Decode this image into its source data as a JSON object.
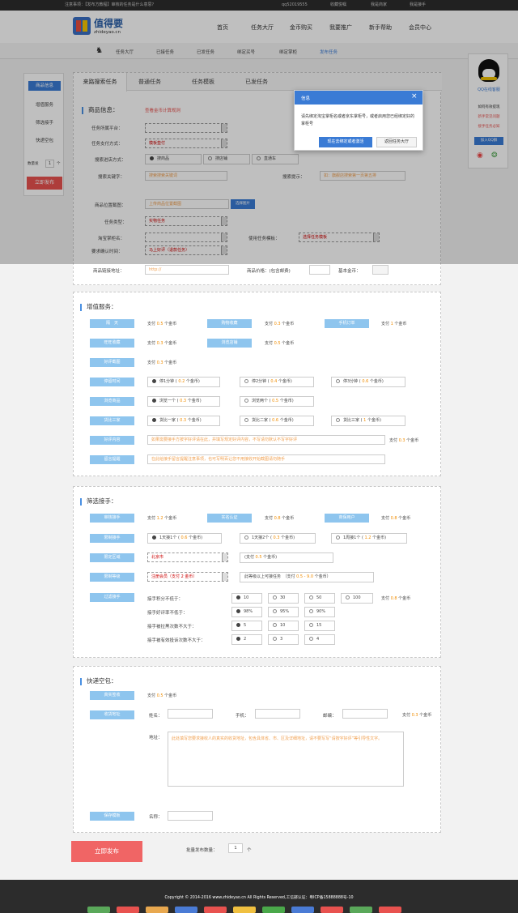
{
  "topbar": {
    "notice": "注意事项：【发布方教程】审核的任务是什么意思？",
    "qq": "qq52019555",
    "fav": "收藏悦嘱",
    "merchant": "我是商家",
    "worker": "我是接手"
  },
  "header": {
    "logo_main": "值得要",
    "logo_sub": "zhideyao.cn",
    "nav": [
      "首页",
      "任务大厅",
      "金币购买",
      "我要推广",
      "新手帮助",
      "会员中心"
    ]
  },
  "subnav": [
    "任务大厅",
    "已接任务",
    "已发任务",
    "绑定买号",
    "绑定掌柜",
    "发布任务"
  ],
  "left_sidebar": {
    "items": [
      "商品信息",
      "增值服务",
      "筛选接手",
      "快递空包"
    ],
    "qty_label": "数量发",
    "qty_value": "1",
    "qty_unit": "个",
    "publish": "立即发布"
  },
  "right_sidebar": {
    "qq_label": "QQ在线客服",
    "links": [
      "如何有效提现",
      "新手常见问题",
      "接手任务必知"
    ],
    "join": "加入QQ群"
  },
  "tabs": [
    "来路搜索任务",
    "普通任务",
    "任务模板",
    "已发任务"
  ],
  "product": {
    "title": "商品信息：",
    "calc_link": "查看金币计算规则",
    "platform_label": "任务所属平台：",
    "pay_label": "任务支付方式：",
    "pay_value": "模板垫付",
    "shop_label": "搜索进店方式：",
    "shop_opts": [
      "搜商品",
      "搜店铺",
      "直通车"
    ],
    "kw_label": "搜索关键字：",
    "kw_ph": "搜索搜索关键词",
    "tip_label": "搜索提示：",
    "tip_ph": "如：旗舰店搜索第一页第五排",
    "pos_label": "商品位置截图：",
    "pos_ph": "上传商品位置截图",
    "pos_btn": "选择图片",
    "type_label": "任务类型：",
    "type_value": "实物任务",
    "shop_name_label": "淘宝掌柜名：",
    "tpl_label": "使用任务模板：",
    "tpl_value": "选择任务模板",
    "confirm_label": "要求确认时间：",
    "confirm_value": "马上好评（退款任务）",
    "link_label": "商品链接地址：",
    "link_ph": "http://",
    "price_label": "商品价格：(包含邮费)",
    "base_label": "基本金币："
  },
  "dialog": {
    "title": "信息",
    "close": "×",
    "text": "请先绑定淘宝掌柜名或者京东掌柜号，或者启用您已经绑定好的掌柜号",
    "btn_bind": "现在去绑定或者激活",
    "btn_back": "返回任务大厅"
  },
  "value_added": {
    "title": "增值服务：",
    "r1": [
      {
        "btn": "隔　天",
        "pay": "支付",
        "val": "0.5",
        "unit": "个金币"
      },
      {
        "btn": "购物收藏",
        "pay": "支付",
        "val": "0.3",
        "unit": "个金币"
      },
      {
        "btn": "手机订单",
        "pay": "支付",
        "val": "1",
        "unit": "个金币"
      }
    ],
    "r2": [
      {
        "btn": "旺旺收藏",
        "pay": "支付",
        "val": "0.3",
        "unit": "个金币"
      },
      {
        "btn": "浏览店铺",
        "pay": "支付",
        "val": "0.5",
        "unit": "个金币"
      }
    ],
    "r3": {
      "btn": "好评截图",
      "pay": "支付",
      "val": "0.3",
      "unit": "个金币"
    },
    "stay": {
      "btn": "停留时间",
      "opts": [
        [
          "停1分钟",
          "0.2"
        ],
        [
          "停2分钟",
          "0.4"
        ],
        [
          "停3分钟",
          "0.6"
        ]
      ]
    },
    "browse": {
      "btn": "浏览商品",
      "opts": [
        [
          "浏览一个",
          "0.3"
        ],
        [
          "浏览两个",
          "0.5"
        ]
      ]
    },
    "compare": {
      "btn": "货比三家",
      "opts": [
        [
          "货比一家",
          "0.3"
        ],
        [
          "货比二家",
          "0.6"
        ],
        [
          "货比三家",
          "1"
        ]
      ]
    },
    "coin_unit": "个金币",
    "review": {
      "btn": "好评内容",
      "ph": "如果需要接手方按字好评请在此，并填写规定好评内容，不写请勿默认不写字好评",
      "pay": "支付",
      "val": "0.3",
      "unit": "个金币"
    },
    "msg": {
      "btn": "留言提醒",
      "ph": "在此给接手留言提醒注意事项，也可写明百让您不用接收开始截图请勿随手"
    }
  },
  "filter": {
    "title": "筛选接手：",
    "r1": [
      {
        "btn": "审核接手",
        "pay": "支付",
        "val": "1.2",
        "unit": "个金币"
      },
      {
        "btn": "实名认证",
        "pay": "支付",
        "val": "0.8",
        "unit": "个金币"
      },
      {
        "btn": "商保用户",
        "pay": "支付",
        "val": "0.8",
        "unit": "个金币"
      }
    ],
    "limit": {
      "btn": "限制接手",
      "opts": [
        [
          "1天接1个",
          "0.6"
        ],
        [
          "1天接2个",
          "0.3"
        ],
        [
          "1周接1个",
          "1.2"
        ]
      ]
    },
    "region": {
      "btn": "限定区域",
      "value": "北京市",
      "note_a": "(支付",
      "note_val": "0.5",
      "note_b": "个金币)"
    },
    "level": {
      "btn": "限制等级",
      "value": "注册会员（支付 2 金币）",
      "note_a": "此等级以上可接任务　（支付",
      "note_val": "0.5 - 9.0",
      "note_b": "个金币）"
    },
    "adv": {
      "btn": "过滤接手",
      "pay": "支付",
      "val": "0.8",
      "unit": "个金币"
    },
    "rows": [
      {
        "label": "接手积分不低于：",
        "opts": [
          "10",
          "30",
          "50",
          "100"
        ]
      },
      {
        "label": "接手好评率不低于：",
        "opts": [
          "98%",
          "95%",
          "90%"
        ]
      },
      {
        "label": "接手被拉黑次数不大于：",
        "opts": [
          "5",
          "10",
          "15"
        ]
      },
      {
        "label": "接手被有效投诉次数不大于：",
        "opts": [
          "2",
          "3",
          "4"
        ]
      }
    ]
  },
  "express": {
    "title": "快递空包：",
    "real": {
      "btn": "真实签收",
      "pay": "支付",
      "val": "0.5",
      "unit": "个金币"
    },
    "addr_btn": "收货地址",
    "name_label": "姓名：",
    "phone_label": "手机：",
    "zip_label": "邮编：",
    "addr_pay": "支付",
    "addr_val": "0.3",
    "addr_unit": "个金币",
    "addr_label": "地址：",
    "addr_ph": "此处填写您要求接收人的真实的收货地址，包含具体省、市、区及详细地址，请不要写写“请按字好评”等引导性文字。",
    "save_btn": "保存模板",
    "save_name": "名称："
  },
  "bottom": {
    "publish": "立即发布",
    "qty_label": "批量发布数量：",
    "qty_value": "1",
    "qty_unit": "个"
  },
  "footer": {
    "copyright": "Copyright © 2014-2016 www.zhideyao.cn All Rights Reserved,工信部认证：粤ICP备15888888号-10"
  }
}
